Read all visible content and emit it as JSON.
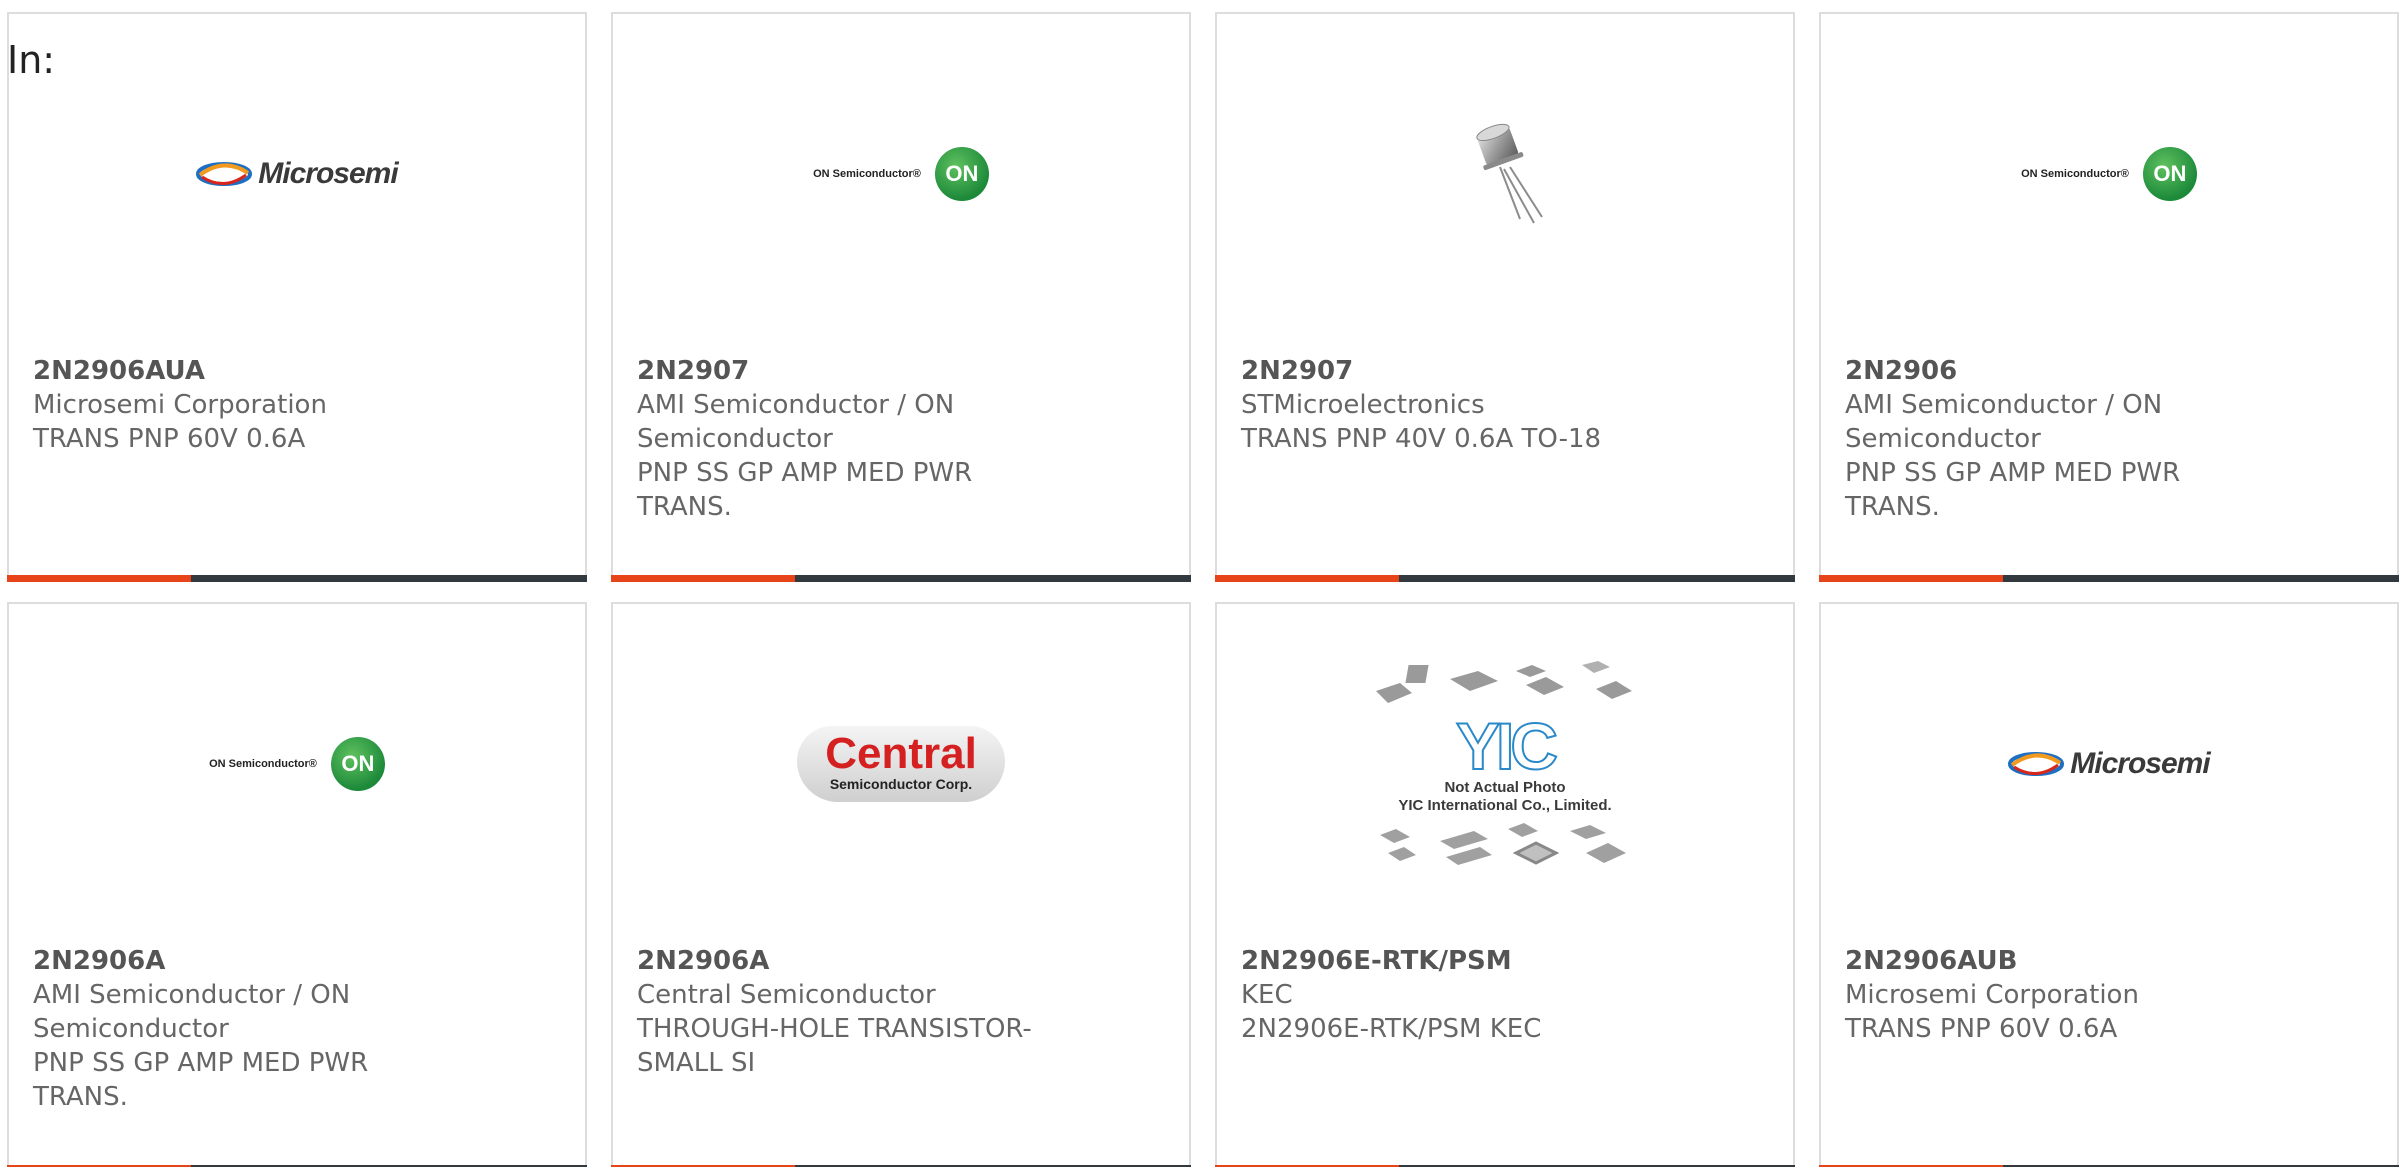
{
  "header": {
    "in_label": "In:"
  },
  "colors": {
    "accent": "#e8441a",
    "bar": "#333a3f",
    "border": "#dddddd"
  },
  "products": [
    {
      "part": "2N2906AUA",
      "manufacturer": "Microsemi Corporation",
      "description": "TRANS PNP 60V 0.6A",
      "image": "microsemi-logo",
      "logo_text": "Microsemi"
    },
    {
      "part": "2N2907",
      "manufacturer": "AMI Semiconductor / ON Semiconductor",
      "description": "PNP SS GP AMP MED PWR TRANS.",
      "image": "on-semiconductor-logo",
      "logo_text": "ON Semiconductor®",
      "logo_mark": "ON"
    },
    {
      "part": "2N2907",
      "manufacturer": "STMicroelectronics",
      "description": "TRANS PNP 40V 0.6A TO-18",
      "image": "to18-transistor-photo"
    },
    {
      "part": "2N2906",
      "manufacturer": "AMI Semiconductor / ON Semiconductor",
      "description": "PNP SS GP AMP MED PWR TRANS.",
      "image": "on-semiconductor-logo",
      "logo_text": "ON Semiconductor®",
      "logo_mark": "ON"
    },
    {
      "part": "2N2906A",
      "manufacturer": "AMI Semiconductor / ON Semiconductor",
      "description": "PNP SS GP AMP MED PWR TRANS.",
      "image": "on-semiconductor-logo",
      "logo_text": "ON Semiconductor®",
      "logo_mark": "ON"
    },
    {
      "part": "2N2906A",
      "manufacturer": "Central Semiconductor",
      "description": "THROUGH-HOLE TRANSISTOR-SMALL SI",
      "image": "central-semiconductor-logo",
      "logo_text": "Central",
      "logo_sub": "Semiconductor Corp."
    },
    {
      "part": "2N2906E-RTK/PSM",
      "manufacturer": "KEC",
      "description": "2N2906E-RTK/PSM KEC",
      "image": "yic-placeholder",
      "logo_text": "YIC",
      "logo_line1": "Not Actual Photo",
      "logo_line2": "YIC International Co., Limited."
    },
    {
      "part": "2N2906AUB",
      "manufacturer": "Microsemi Corporation",
      "description": "TRANS PNP 60V 0.6A",
      "image": "microsemi-logo",
      "logo_text": "Microsemi"
    }
  ]
}
